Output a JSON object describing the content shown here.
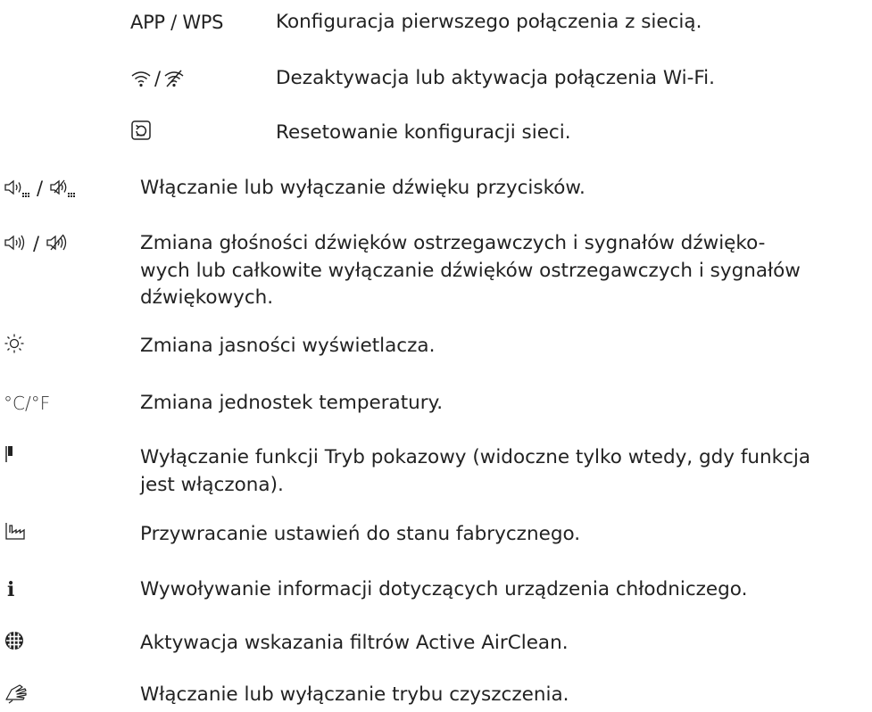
{
  "network_options": [
    {
      "symbol": "APP / WPS",
      "description": "Konfiguracja pierwszego połączenia z siecią."
    },
    {
      "symbol_icons": [
        "wifi-icon",
        "wifi-off-icon"
      ],
      "separator": "/",
      "description": "Dezaktywacja lub aktywacja połączenia Wi-Fi."
    },
    {
      "symbol_icons": [
        "network-reset-icon"
      ],
      "description": "Resetowanie konfiguracji sieci."
    }
  ],
  "settings": [
    {
      "symbol_icons": [
        "key-sound-on-icon",
        "key-sound-off-icon"
      ],
      "separator": "/",
      "description": "Włączanie lub wyłączanie dźwięku przycisków."
    },
    {
      "symbol_icons": [
        "volume-icon",
        "mute-icon"
      ],
      "separator": "/",
      "description": "Zmiana głośności dźwięków ostrzegawczych i sygnałów dźwięko-wych lub całkowite wyłączanie dźwięków ostrzegawczych i sygnałów dźwiękowych.",
      "description_lines": [
        "Zmiana głośności dźwięków ostrzegawczych i sygnałów dźwięko-",
        "wych lub całkowite wyłączanie dźwięków ostrzegawczych i sygnałów",
        "dźwiękowych."
      ]
    },
    {
      "symbol_icons": [
        "brightness-icon"
      ],
      "description": "Zmiana jasności wyświetlacza."
    },
    {
      "symbol": "°C/°F",
      "description": "Zmiana jednostek temperatury."
    },
    {
      "symbol_icons": [
        "demo-mode-icon"
      ],
      "description": "Wyłączanie funkcji Tryb pokazowy (widoczne tylko wtedy, gdy funkcja jest włączona).",
      "description_lines": [
        "Wyłączanie funkcji Tryb pokazowy (widoczne tylko wtedy, gdy funkcja",
        "jest włączona)."
      ]
    },
    {
      "symbol_icons": [
        "factory-reset-icon"
      ],
      "description": "Przywracanie ustawień do stanu fabrycznego."
    },
    {
      "symbol_icons": [
        "info-icon"
      ],
      "description": "Wywoływanie informacji dotyczących urządzenia chłodniczego."
    },
    {
      "symbol_icons": [
        "filter-icon"
      ],
      "description": "Aktywacja wskazania filtrów Active AirClean."
    },
    {
      "symbol_icons": [
        "cleaning-mode-icon"
      ],
      "description": "Włączanie lub wyłączanie trybu czyszczenia."
    }
  ]
}
